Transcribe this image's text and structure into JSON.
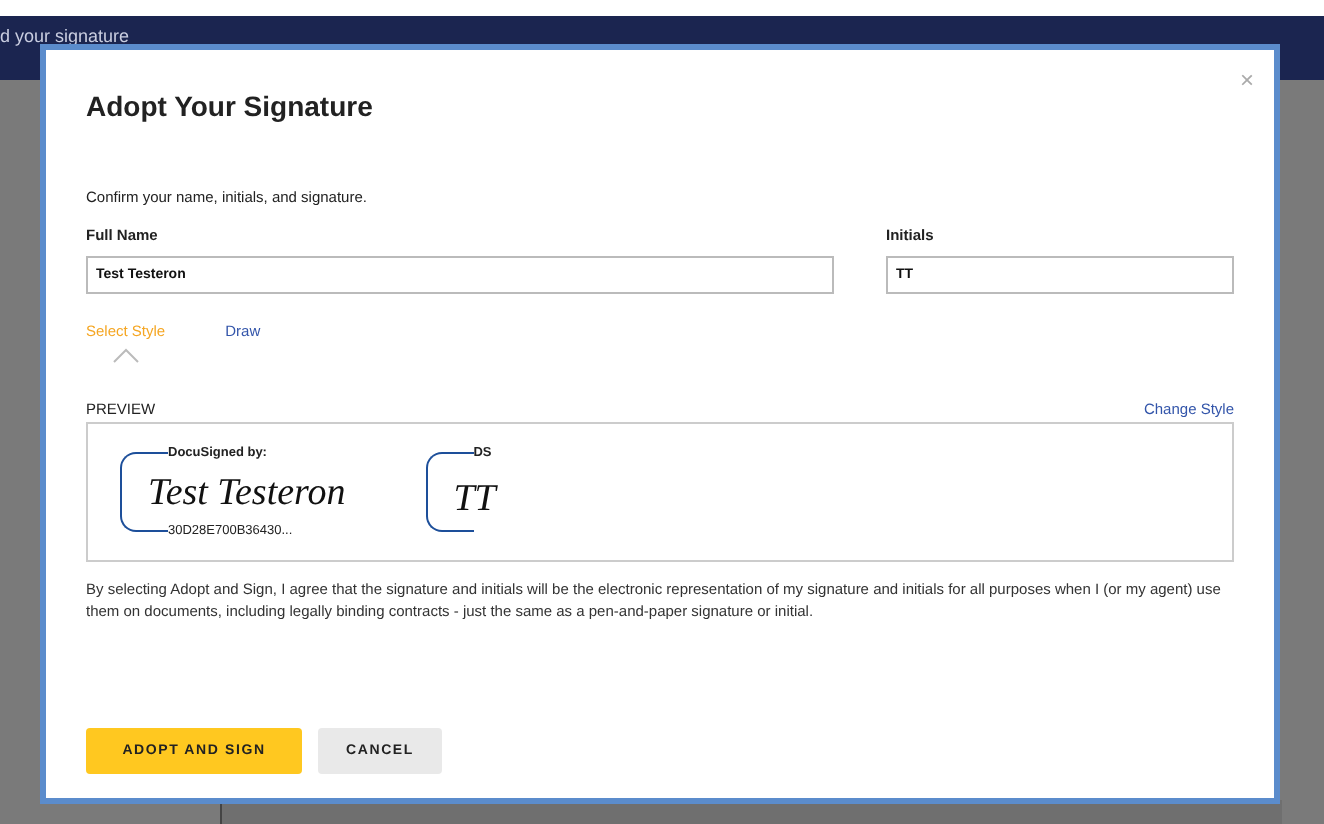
{
  "background": {
    "header_text": "d your signature"
  },
  "dialog": {
    "title": "Adopt Your Signature",
    "close": "×",
    "intro": "Confirm your name, initials, and signature.",
    "fields": [
      {
        "label": "Full Name",
        "value": "Test Testeron"
      },
      {
        "label": "Initials",
        "value": "TT"
      }
    ],
    "tabs": [
      {
        "label": "Select Style",
        "selected": true
      },
      {
        "label": "Draw",
        "selected": false
      }
    ],
    "preview": {
      "label": "PREVIEW",
      "change_link": "Change Style",
      "signature": {
        "caption": "DocuSigned by:",
        "text": "Test Testeron",
        "code": "30D28E700B36430..."
      },
      "initials": {
        "caption": "DS",
        "text": "TT"
      }
    },
    "disclaimer": "By selecting Adopt and Sign, I agree that the signature and initials will be the electronic representation of my signature and initials for all purposes when I (or my agent) use them on documents, including legally binding contracts - just the same as a pen-and-paper signature or initial.",
    "buttons": [
      {
        "label": "ADOPT AND SIGN",
        "kind": "primary"
      },
      {
        "label": "CANCEL",
        "kind": "secondary"
      }
    ]
  }
}
